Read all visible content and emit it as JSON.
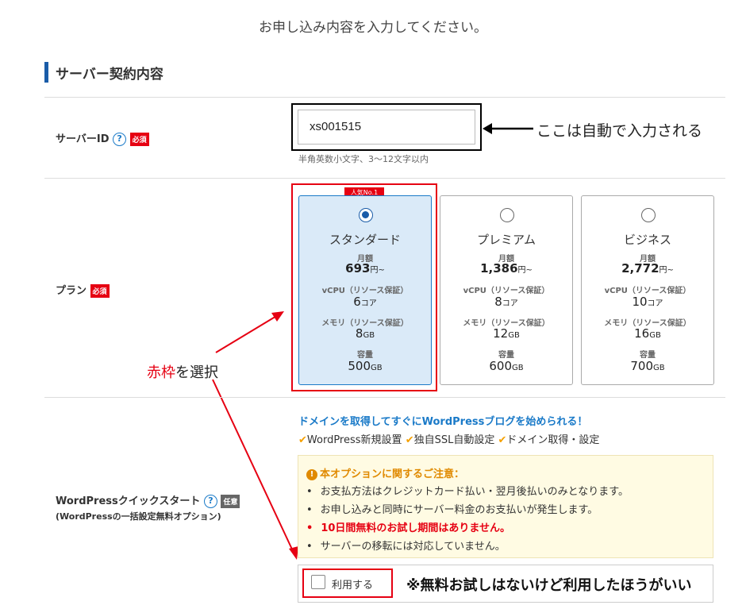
{
  "page": {
    "intro": "お申し込み内容を入力してください。",
    "section_title": "サーバー契約内容"
  },
  "server_id": {
    "label": "サーバーID",
    "help": "?",
    "required_badge": "必須",
    "value": "xs001515",
    "hint": "半角英数小文字、3〜12文字以内",
    "annotation": "ここは自動で入力される"
  },
  "plan": {
    "label": "プラン",
    "required_badge": "必須",
    "popular_badge": "人気No.1",
    "monthly_label": "月額",
    "vcpu_label": "vCPU（リソース保証）",
    "memory_label": "メモリ（リソース保証）",
    "storage_label": "容量",
    "price_suffix": "円~",
    "vcpu_unit": "コア",
    "gb_unit": "GB",
    "cards": [
      {
        "name": "スタンダード",
        "price": "693",
        "vcpu": "6",
        "memory": "8",
        "storage": "500",
        "selected": true
      },
      {
        "name": "プレミアム",
        "price": "1,386",
        "vcpu": "8",
        "memory": "12",
        "storage": "600",
        "selected": false
      },
      {
        "name": "ビジネス",
        "price": "2,772",
        "vcpu": "10",
        "memory": "16",
        "storage": "700",
        "selected": false
      }
    ],
    "annotation_red": "赤枠",
    "annotation_rest": "を選択"
  },
  "wordpress": {
    "label": "WordPressクイックスタート",
    "help": "?",
    "optional_badge": "任意",
    "sub_label": "(WordPressの一括設定無料オプション)",
    "headline": "ドメインを取得してすぐにWordPressブログを始められる！",
    "features": [
      "WordPress新規設置",
      "独自SSL自動設定",
      "ドメイン取得・設定"
    ],
    "note_title": "本オプションに関するご注意：",
    "notes": [
      {
        "text": "お支払方法はクレジットカード払い・翌月後払いのみとなります。",
        "red": false
      },
      {
        "text": "お申し込みと同時にサーバー料金のお支払いが発生します。",
        "red": false
      },
      {
        "text": "10日間無料のお試し期間はありません。",
        "red": true
      },
      {
        "text": "サーバーの移転には対応していません。",
        "red": false
      }
    ],
    "checkbox_label": "利用する",
    "annotation": "※無料お試しはないけど利用したほうがいい"
  },
  "colors": {
    "accent_blue": "#1a7ac8",
    "required_red": "#e60012",
    "highlight_red": "#e60012",
    "selected_card_bg": "#daeaf8",
    "note_bg": "#fffbe3"
  }
}
